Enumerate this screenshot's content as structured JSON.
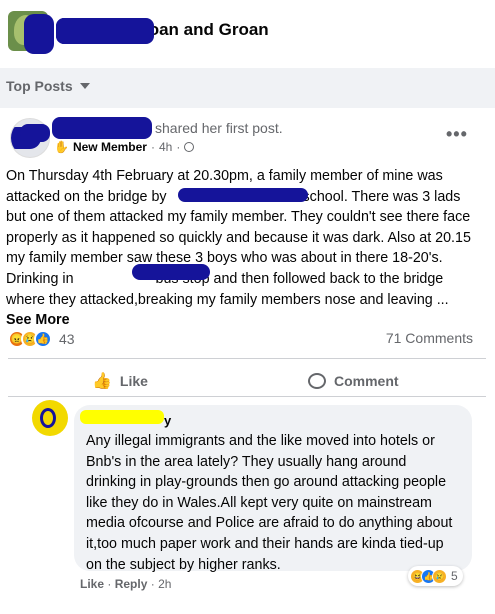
{
  "group": {
    "name_suffix": "hy Moan and Groan"
  },
  "feed": {
    "sort_label": "Top Posts"
  },
  "post": {
    "shared_text": "shared her first post.",
    "badge": "New Member",
    "time": "4h",
    "body_segments": [
      "On Thursday 4th February at 20.30pm, a family member of mine was attacked on the bridge by",
      "school. There was 3 lads but one of them attacked my family member. They couldn't see there face properly as it happened so quickly and because it was dark. Also at 20.15 my family member saw these 3 boys who was about in there 18-20's. Drinking in",
      "bus stop and then followed back to the bridge where they attacked,breaking my family members nose and leaving ...",
      "See More"
    ],
    "reaction_count": "43",
    "comments_count": "71 Comments",
    "actions": {
      "like": "Like",
      "comment": "Comment"
    },
    "icons": {
      "member": "hand-icon",
      "privacy": "globe-icon",
      "menu": "more-dots-icon"
    }
  },
  "comment": {
    "author_suffix": "y",
    "text": "Any illegal immigrants and the like moved into hotels or Bnb's in the area lately? They usually hang around drinking in play-grounds then go around attacking people like they do in Wales.All kept very quite on mainstream media ofcourse and Police are afraid to do anything about it,too much paper work and their hands are kinda tied-up on the subject by higher ranks.",
    "like_label": "Like",
    "reply_label": "Reply",
    "time": "2h",
    "reaction_count": "5"
  },
  "colors": {
    "redaction": "#15149a",
    "highlight": "#ffff00",
    "accent": "#1877f2"
  }
}
